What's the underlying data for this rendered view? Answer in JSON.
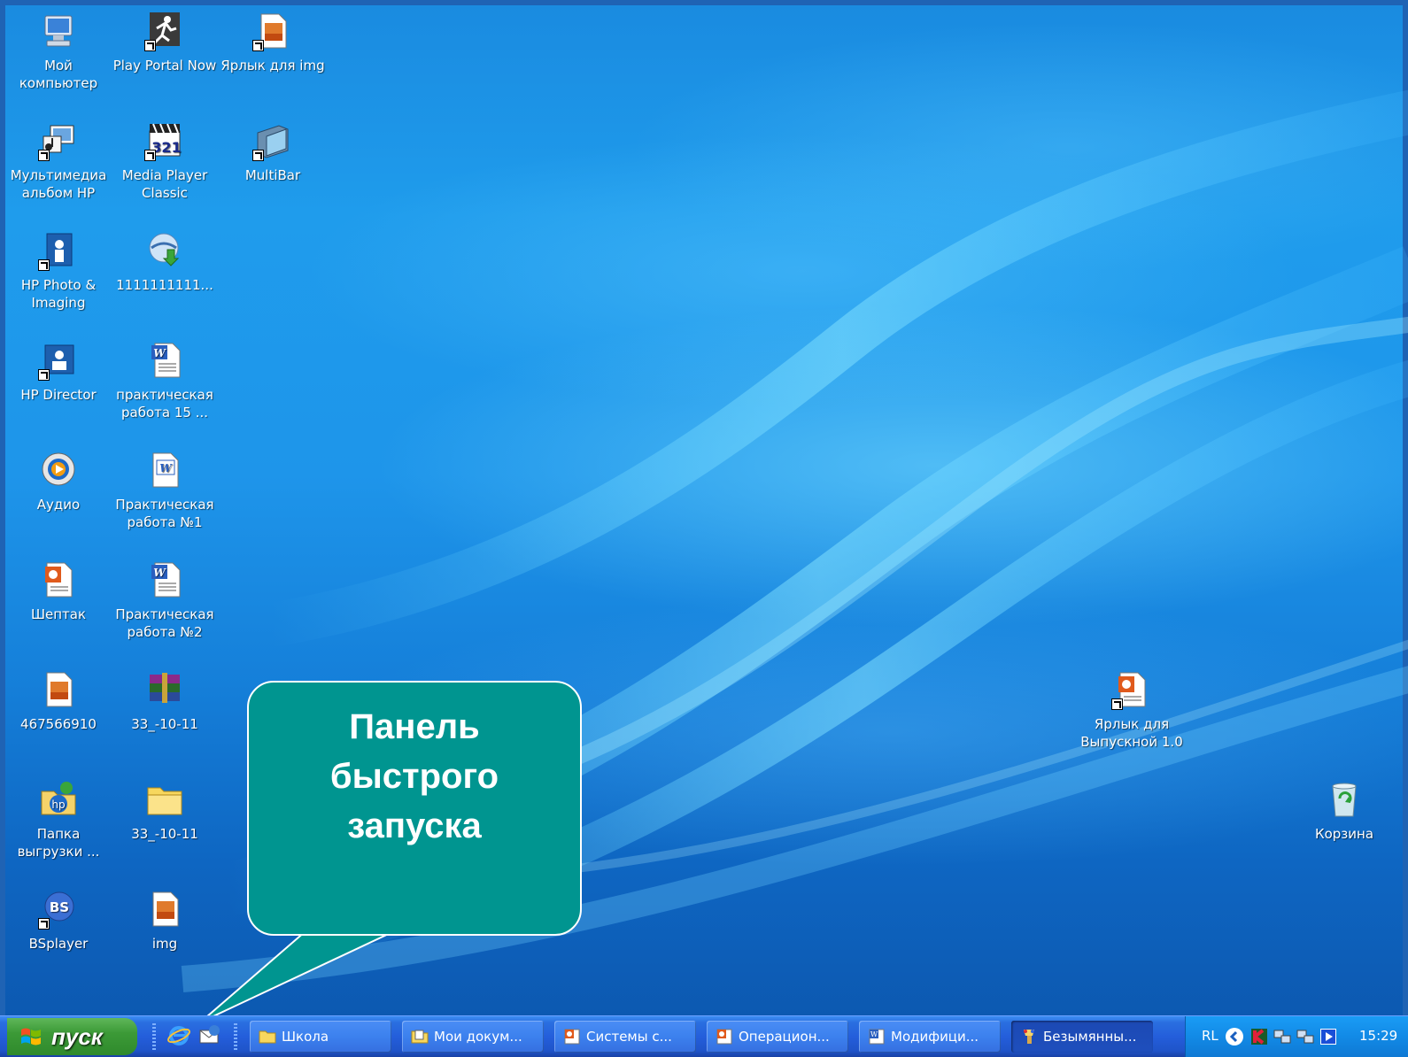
{
  "desktop": {
    "icons_col1": [
      {
        "label": "Мой компьютер",
        "icon": "my-computer-icon"
      },
      {
        "label": "Мультимедиа альбом HP",
        "icon": "hp-media-album-icon"
      },
      {
        "label": "HP Photo & Imaging",
        "icon": "hp-photo-imaging-icon"
      },
      {
        "label": "HP Director",
        "icon": "hp-director-icon"
      },
      {
        "label": "Аудио",
        "icon": "audio-player-icon"
      },
      {
        "label": "Шептак",
        "icon": "powerpoint-file-icon"
      },
      {
        "label": "467566910",
        "icon": "image-file-icon"
      },
      {
        "label": "Папка выгрузки ...",
        "icon": "hp-upload-folder-icon"
      },
      {
        "label": "BSplayer",
        "icon": "bsplayer-icon"
      }
    ],
    "icons_col2": [
      {
        "label": "Play Portal Now",
        "icon": "play-portal-icon"
      },
      {
        "label": "Media Player Classic",
        "icon": "media-player-classic-icon"
      },
      {
        "label": "1111111111...",
        "icon": "download-file-icon"
      },
      {
        "label": "практическая работа 15 ...",
        "icon": "word-document-icon"
      },
      {
        "label": "Практическая работа №1",
        "icon": "word-document-icon"
      },
      {
        "label": "Практическая работа №2",
        "icon": "word-document-icon"
      },
      {
        "label": "33_-10-11",
        "icon": "winrar-archive-icon"
      },
      {
        "label": "33_-10-11",
        "icon": "folder-icon"
      },
      {
        "label": "img",
        "icon": "image-file-icon"
      }
    ],
    "icons_col3": [
      {
        "label": "Ярлык для img",
        "icon": "image-shortcut-icon"
      },
      {
        "label": "MultiBar",
        "icon": "multibar-icon"
      }
    ],
    "icons_right": [
      {
        "label": "Ярлык для Выпускной 1.0",
        "icon": "powerpoint-shortcut-icon"
      },
      {
        "label": "Корзина",
        "icon": "recycle-bin-icon"
      }
    ]
  },
  "callout": {
    "lines": [
      "Панель",
      "быстрого",
      "запуска"
    ],
    "color": "#009590"
  },
  "taskbar": {
    "start_label": "пуск",
    "quick_launch": [
      "internet-explorer-icon",
      "outlook-express-icon"
    ],
    "tasks": [
      {
        "label": "Школа",
        "icon": "folder-icon",
        "active": false
      },
      {
        "label": "Мои докум...",
        "icon": "my-documents-icon",
        "active": false
      },
      {
        "label": "Системы с...",
        "icon": "powerpoint-icon",
        "active": false
      },
      {
        "label": "Операцион...",
        "icon": "powerpoint-icon",
        "active": false
      },
      {
        "label": "Модифици...",
        "icon": "word-icon",
        "active": false
      },
      {
        "label": "Безымянны...",
        "icon": "paint-icon",
        "active": true
      }
    ],
    "tray": {
      "language": "RL",
      "icons": [
        "show-hidden-icon",
        "kaspersky-icon",
        "network-icon",
        "network-icon",
        "media-icon"
      ],
      "clock": "15:29"
    }
  },
  "colors": {
    "taskbar": "#245edb",
    "start_button": "#3c9a37",
    "tray": "#128ae6",
    "desktop": "#1e95ea"
  }
}
